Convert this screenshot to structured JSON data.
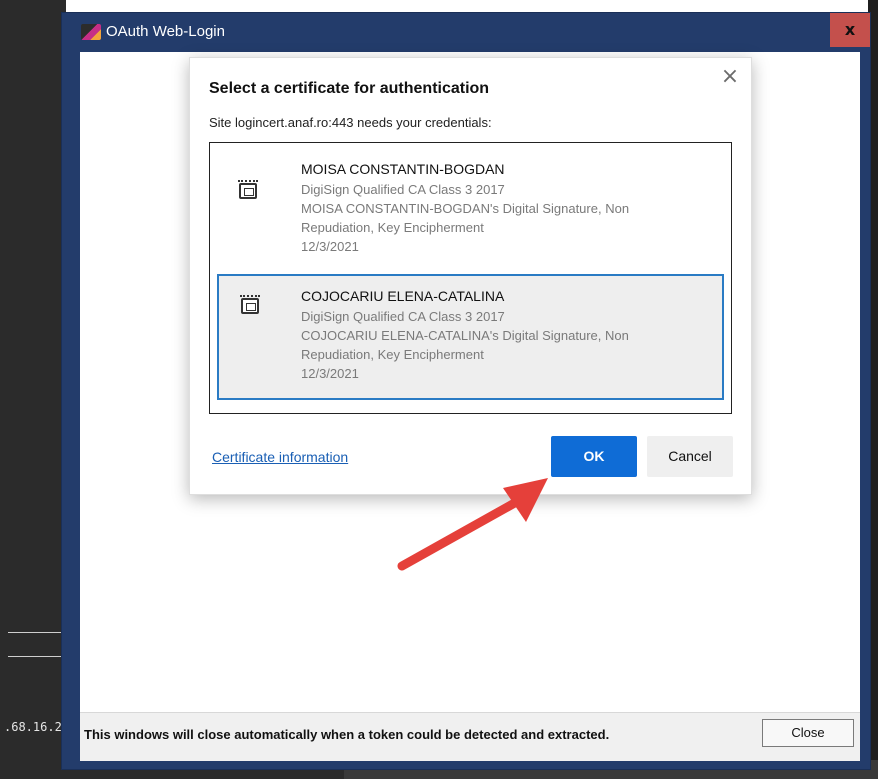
{
  "background": {
    "ip_fragment": ".68.16.2"
  },
  "window": {
    "title": "OAuth Web-Login",
    "close_glyph": "x",
    "status_message": "This windows will close automatically when a token could be detected and extracted.",
    "close_button_label": "Close"
  },
  "dialog": {
    "title": "Select a certificate for authentication",
    "subtitle": "Site logincert.anaf.ro:443 needs your credentials:",
    "close_glyph": "×",
    "certificates": [
      {
        "name": "MOISA CONSTANTIN-BOGDAN",
        "issuer": "DigiSign Qualified CA Class 3 2017",
        "usage_line1": "MOISA CONSTANTIN-BOGDAN's Digital Signature, Non",
        "usage_line2": "Repudiation, Key Encipherment",
        "date": "12/3/2021",
        "selected": false
      },
      {
        "name": "COJOCARIU ELENA-CATALINA",
        "issuer": "DigiSign Qualified CA Class 3 2017",
        "usage_line1": "COJOCARIU ELENA-CATALINA's Digital Signature, Non",
        "usage_line2": "Repudiation, Key Encipherment",
        "date": "12/3/2021",
        "selected": true
      }
    ],
    "cert_info_link": "Certificate information",
    "ok_label": "OK",
    "cancel_label": "Cancel"
  },
  "colors": {
    "window_frame": "#233c6b",
    "close_button_red": "#c4504c",
    "ok_blue": "#0f6cd6",
    "selection_border": "#2a7bc4",
    "annotation_arrow": "#e5403a"
  },
  "icons": {
    "app": "oauth-app-icon",
    "certificate": "smartcard-chip-icon"
  }
}
